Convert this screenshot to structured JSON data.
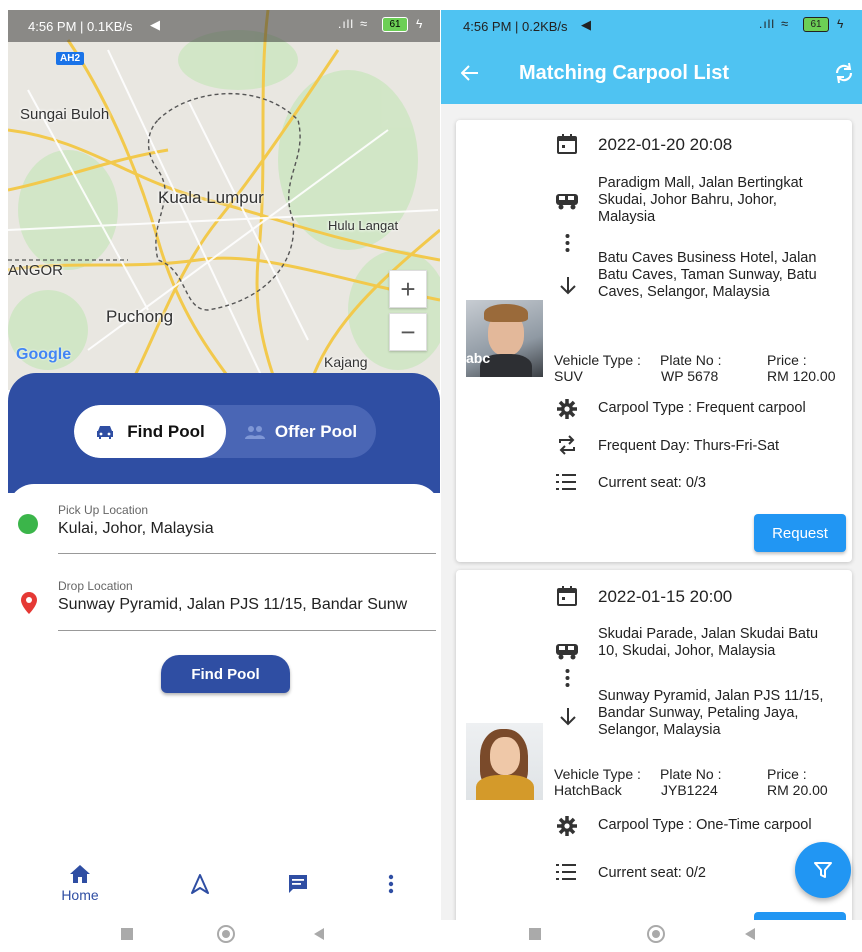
{
  "left": {
    "status_bar": {
      "time": "4:56 PM | 0.1KB/s",
      "battery": "61"
    },
    "map": {
      "highway_badge": "AH2",
      "labels": {
        "sungai_buloh": "Sungai Buloh",
        "kuala_lumpur": "Kuala Lumpur",
        "hulu_langat": "Hulu Langat",
        "langor": "ANGOR",
        "puchong": "Puchong",
        "kajang": "Kajang"
      },
      "google_logo": "Google",
      "zoom_in": "+",
      "zoom_out": "−"
    },
    "toggle": {
      "find_label": "Find Pool",
      "offer_label": "Offer Pool",
      "selected": "find"
    },
    "pickup": {
      "label": "Pick Up Location",
      "value": "Kulai, Johor, Malaysia"
    },
    "drop": {
      "label": "Drop Location",
      "value": "Sunway Pyramid, Jalan PJS 11/15, Bandar Sunw"
    },
    "find_button": "Find Pool",
    "bottom_nav": {
      "home_label": "Home"
    }
  },
  "right": {
    "status_bar": {
      "time": "4:56 PM | 0.2KB/s",
      "battery": "61"
    },
    "app_bar": {
      "title": "Matching Carpool List"
    },
    "cards": [
      {
        "datetime": "2022-01-20 20:08",
        "from": "Paradigm Mall, Jalan Bertingkat Skudai, Johor Bahru, Johor, Malaysia",
        "to": "Batu Caves Business Hotel, Jalan Batu Caves, Taman Sunway, Batu Caves, Selangor, Malaysia",
        "vehicle_type_label": "Vehicle Type :",
        "vehicle_type": "SUV",
        "plate_label": "Plate No :",
        "plate": "WP 5678",
        "price_label": "Price :",
        "price": "RM 120.00",
        "carpool_type": "Carpool Type : Frequent carpool",
        "frequent_day": "Frequent Day: Thurs-Fri-Sat",
        "seat": "Current seat: 0/3",
        "request_label": "Request",
        "avatar_overlay": "abc"
      },
      {
        "datetime": "2022-01-15 20:00",
        "from": "Skudai Parade, Jalan Skudai Batu 10, Skudai, Johor, Malaysia",
        "to": "Sunway Pyramid, Jalan PJS 11/15, Bandar Sunway, Petaling Jaya, Selangor, Malaysia",
        "vehicle_type_label": "Vehicle Type :",
        "vehicle_type": "HatchBack",
        "plate_label": "Plate No :",
        "plate": "JYB1224",
        "price_label": "Price :",
        "price": "RM 20.00",
        "carpool_type": "Carpool Type : One-Time carpool",
        "seat": "Current seat: 0/2"
      }
    ]
  },
  "colors": {
    "primary_blue": "#2f4ea3",
    "appbar_cyan": "#4fc3f2",
    "button_blue": "#2196f3",
    "pickup_green": "#3bb54a",
    "drop_red": "#e53935"
  }
}
